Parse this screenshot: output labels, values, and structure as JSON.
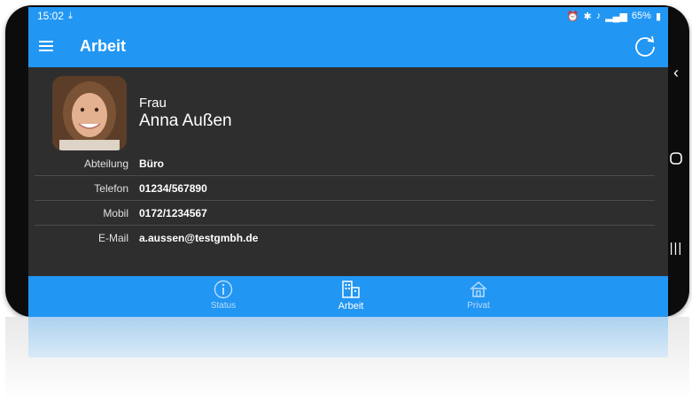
{
  "status_bar": {
    "time": "15:02",
    "download_icon": "download-icon",
    "battery": "65%"
  },
  "app_bar": {
    "title": "Arbeit",
    "menu_icon": "hamburger-icon",
    "refresh_icon": "refresh-icon"
  },
  "profile": {
    "salutation": "Frau",
    "name": "Anna Außen"
  },
  "details": [
    {
      "label": "Abteilung",
      "value": "Büro"
    },
    {
      "label": "Telefon",
      "value": "01234/567890"
    },
    {
      "label": "Mobil",
      "value": "0172/1234567"
    },
    {
      "label": "E-Mail",
      "value": "a.aussen@testgmbh.de"
    }
  ],
  "bottom_nav": [
    {
      "label": "Status",
      "icon": "info-icon",
      "active": false
    },
    {
      "label": "Arbeit",
      "icon": "building-icon",
      "active": true
    },
    {
      "label": "Privat",
      "icon": "home-icon",
      "active": false
    }
  ],
  "colors": {
    "primary": "#2196f3",
    "background": "#2e2e2e",
    "divider": "#4c4c4c"
  }
}
